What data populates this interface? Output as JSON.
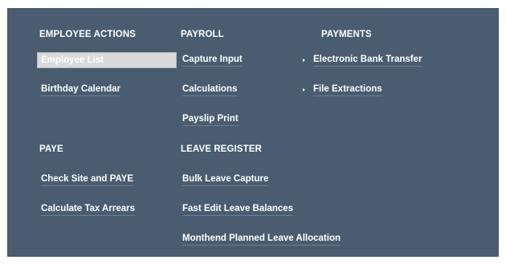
{
  "sections": {
    "employee_actions": {
      "header": "EMPLOYEE ACTIONS",
      "links": [
        "Employee List",
        "Birthday Calendar"
      ]
    },
    "payroll": {
      "header": "PAYROLL",
      "links": [
        "Capture Input",
        "Calculations",
        "Payslip Print"
      ]
    },
    "payments": {
      "header": "PAYMENTS",
      "links": [
        "Electronic Bank Transfer",
        "File Extractions"
      ]
    },
    "paye": {
      "header": "PAYE",
      "links": [
        "Check Site and PAYE",
        "Calculate Tax Arrears"
      ]
    },
    "leave_register": {
      "header": "LEAVE REGISTER",
      "links": [
        "Bulk Leave Capture",
        "Fast Edit Leave Balances",
        "Monthend Planned Leave Allocation"
      ]
    }
  },
  "selected_item": "Employee List",
  "colors": {
    "panel": "#495c70",
    "text": "#ffffff",
    "selected_bg": "#dadada"
  }
}
